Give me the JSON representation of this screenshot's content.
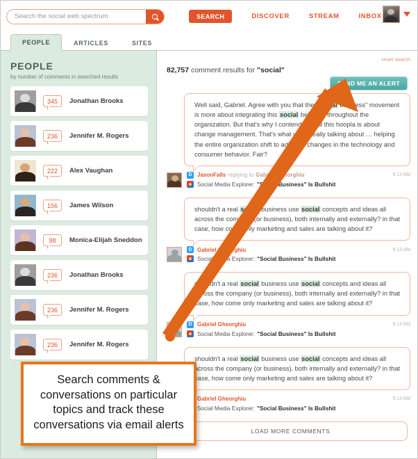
{
  "header": {
    "search": {
      "placeholder": "Search the social web spectrum",
      "value": "",
      "icon": "search-icon"
    },
    "nav": {
      "search_label": "SEARCH",
      "discover_label": "DISCOVER",
      "stream_label": "STREAM",
      "inbox_label": "INBOX"
    },
    "avatar_icon": "avatar",
    "caret_icon": "chevron-down-icon"
  },
  "tabs": [
    {
      "label": "PEOPLE",
      "active": true
    },
    {
      "label": "ARTICLES",
      "active": false
    },
    {
      "label": "SITES",
      "active": false
    }
  ],
  "sidebar": {
    "title": "PEOPLE",
    "subtitle": "by number of comments in searched results",
    "people": [
      {
        "count": "345",
        "name": "Jonathan Brooks",
        "skin": "#dcdcdc",
        "hair": "#3a3a3a",
        "bg": "#9f9f9f"
      },
      {
        "count": "236",
        "name": "Jennifer M. Rogers",
        "skin": "#e8c0a8",
        "hair": "#6b3b28",
        "bg": "#b8c4d4"
      },
      {
        "count": "222",
        "name": "Alex Vaughan",
        "skin": "#d8a477",
        "hair": "#2e2218",
        "bg": "#efe6d2"
      },
      {
        "count": "156",
        "name": "James Wilson",
        "skin": "#d9a97f",
        "hair": "#2a2520",
        "bg": "#8fb8cf"
      },
      {
        "count": "98",
        "name": "Monica-Elijah Sneddon",
        "skin": "#e6bfa6",
        "hair": "#5a3322",
        "bg": "#c3b5d4"
      },
      {
        "count": "236",
        "name": "Jonathan Brooks",
        "skin": "#dcdcdc",
        "hair": "#3a3a3a",
        "bg": "#9f9f9f"
      },
      {
        "count": "236",
        "name": "Jennifer M. Rogers",
        "skin": "#e8c0a8",
        "hair": "#6b3b28",
        "bg": "#b8c4d4"
      },
      {
        "count": "236",
        "name": "Jennifer M. Rogers",
        "skin": "#e8c0a8",
        "hair": "#6b3b28",
        "bg": "#b8c4d4"
      }
    ]
  },
  "main": {
    "reset_label": "reset search",
    "results_count": "82,757",
    "results_text_before": " comment results for ",
    "results_query": "\"social\"",
    "alert_button": "SEND ME AN ALERT",
    "load_more": "LOAD MORE COMMENTS",
    "comments": [
      {
        "body_parts": [
          {
            "t": "Well said, Gabriel. Agree with you that the \"",
            "hl": false
          },
          {
            "t": "social",
            "hl": true
          },
          {
            "t": " business\" movement is more about integrating this ",
            "hl": false
          },
          {
            "t": "social",
            "hl": true
          },
          {
            "t": " behavior throughout the organization. But that's why I contend that all this hoopla is about change management. That's what we're really talking about … helping the entire organization shift to adjust to changes in the technology and consumer behavior. Fair?",
            "hl": false
          }
        ],
        "author": "JasonFalls",
        "reply_prefix": "replying to",
        "reply_target": "Gabriel Gheorghiu",
        "time": "9:13 AM",
        "source_prefix": "Social Media Explorer:",
        "source_title": "\"Social Business\" Is Bullshit",
        "network_icon": "disqus-icon",
        "site_icon": "site-favicon"
      },
      {
        "body_parts": [
          {
            "t": "shouldn't a real ",
            "hl": false
          },
          {
            "t": "social",
            "hl": true
          },
          {
            "t": " business use ",
            "hl": false
          },
          {
            "t": "social",
            "hl": true
          },
          {
            "t": " concepts and ideas all across the company (or business), both internally and externally? in that case, how come only marketing and sales are talking about it?",
            "hl": false
          }
        ],
        "author": "Gabriel Gheorghiu",
        "reply_prefix": "",
        "reply_target": "",
        "time": "9:13 AM",
        "source_prefix": "Social Media Explorer:",
        "source_title": "\"Social Business\" Is Bullshit",
        "network_icon": "disqus-icon",
        "site_icon": "site-favicon"
      },
      {
        "body_parts": [
          {
            "t": "shouldn't a real ",
            "hl": false
          },
          {
            "t": "social",
            "hl": true
          },
          {
            "t": " business use ",
            "hl": false
          },
          {
            "t": "social",
            "hl": true
          },
          {
            "t": " concepts and ideas all across the company (or business), both internally and externally? in that case, how come only marketing and sales are talking about it?",
            "hl": false
          }
        ],
        "author": "Gabriel Gheorghiu",
        "reply_prefix": "",
        "reply_target": "",
        "time": "9:13 AM",
        "source_prefix": "Social Media Explorer:",
        "source_title": "\"Social Business\" Is Bullshit",
        "network_icon": "disqus-icon",
        "site_icon": "site-favicon"
      },
      {
        "body_parts": [
          {
            "t": "shouldn't a real ",
            "hl": false
          },
          {
            "t": "social",
            "hl": true
          },
          {
            "t": " business use ",
            "hl": false
          },
          {
            "t": "social",
            "hl": true
          },
          {
            "t": " concepts and ideas all across the company (or business), both internally and externally? in that case, how come only marketing and sales are talking about it?",
            "hl": false
          }
        ],
        "author": "Gabriel Gheorghiu",
        "reply_prefix": "",
        "reply_target": "",
        "time": "9:13 AM",
        "source_prefix": "Social Media Explorer:",
        "source_title": "\"Social Business\" Is Bullshit",
        "network_icon": "disqus-icon",
        "site_icon": "site-favicon"
      }
    ]
  },
  "annotation": {
    "callout_text": "Search comments & conversations on particular topics and track these conversations via email alerts",
    "arrow_color": "#e0661a",
    "border_color": "#e8761a"
  },
  "colors": {
    "accent_orange": "#e0552b",
    "teal": "#4aa7a4",
    "sidebar_green": "#dcebdf",
    "highlight_green": "#d9ecdc"
  }
}
